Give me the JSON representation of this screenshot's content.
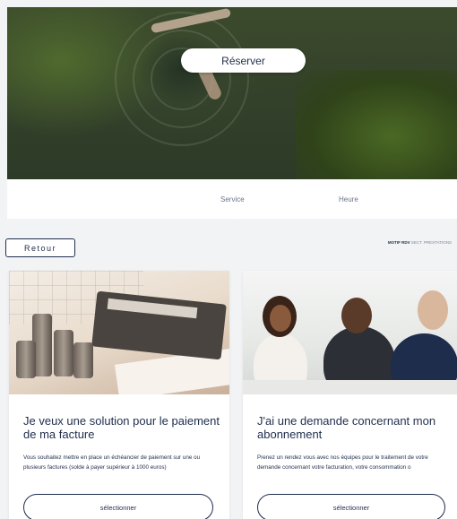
{
  "hero": {
    "reserve_label": "Réserver"
  },
  "steps": [
    {
      "label": "Service"
    },
    {
      "label": "Heure"
    }
  ],
  "back": {
    "label": "Retour"
  },
  "breadcrumb": {
    "label": "MOTIF RDV",
    "path": "SECT. PRESTATIONS"
  },
  "cards": [
    {
      "title": "Je veux une solution pour le paiement de ma facture",
      "description": "Vous souhaitez mettre en place un échéancier de paiement sur une ou plusieurs factures (solde à payer supérieur à 1000 euros)",
      "button": "sélectionner"
    },
    {
      "title": "J'ai une demande concernant mon abonnement",
      "description": "Prenez un rendez vous avec nos équipes pour le traitement de votre demande concernant votre facturation, votre consommation o",
      "button": "sélectionner"
    }
  ],
  "colors": {
    "brand_navy": "#1f2d4d",
    "muted": "#6b7689"
  }
}
